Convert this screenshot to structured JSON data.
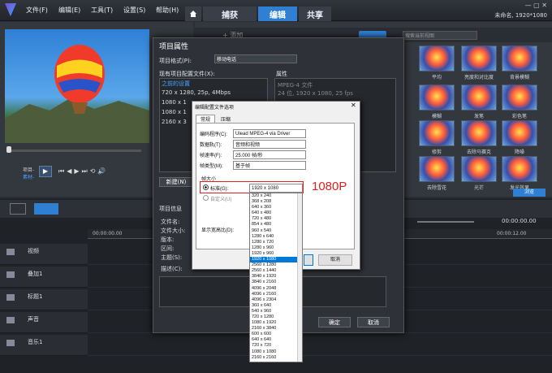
{
  "app": {
    "title": "未命名, 1920*1080"
  },
  "menu": [
    "文件(F)",
    "编辑(E)",
    "工具(T)",
    "设置(S)",
    "帮助(H)"
  ],
  "tabs": {
    "capture": "捕获",
    "edit": "编辑",
    "share": "共享"
  },
  "library": {
    "add": "添加",
    "search_placeholder": "搜索当前视图",
    "items": [
      {
        "label": ""
      },
      {
        "label": "平均"
      },
      {
        "label": "亮度和对比度"
      },
      {
        "label": "背景模糊"
      },
      {
        "label": "模糊"
      },
      {
        "label": "发笔"
      },
      {
        "label": "彩色笔"
      },
      {
        "label": "修剪"
      },
      {
        "label": "去除马赛克"
      },
      {
        "label": "降噪"
      },
      {
        "label": "去除雪花"
      },
      {
        "label": "光芒"
      },
      {
        "label": "发光效果"
      }
    ],
    "footer": "浏览"
  },
  "player": {
    "project": "项目-",
    "clip": "素材-"
  },
  "timeline": {
    "time": "00:00:00.00",
    "ruler": [
      "00:00:00.00",
      "00:00:02.00",
      "00:00:12.00"
    ],
    "tracks": [
      "视频",
      "叠加1",
      "标题1",
      "声音",
      "音乐1"
    ]
  },
  "project_props": {
    "title": "项目属性",
    "format_label": "项目格式(P):",
    "format_value": "移动电话",
    "profiles_label": "现有项目配置文件(X):",
    "profiles": [
      "之前的设置",
      "720 x 1280, 25p, 4Mbps",
      "1080 x 1",
      "1080 x 1",
      "2160 x 3"
    ],
    "attributes_label": "属性",
    "attributes": [
      "MPEG-4 文件",
      "24 位, 1920 x 1080, 25 fps"
    ],
    "new_button": "新建(N)",
    "info_label": "项目信息",
    "info_fields": [
      "文件名:",
      "文件大小:",
      "版本:",
      "区间:",
      "主题(S):",
      "描述(C):"
    ],
    "ok": "确定",
    "cancel": "取消"
  },
  "edit_dialog": {
    "title": "编辑配置文件选项",
    "tabs": [
      "常规",
      "压缩"
    ],
    "fields": [
      {
        "label": "编码程序(C):",
        "value": "Ulead MPEG-4 via Driver"
      },
      {
        "label": "数据轨(T):",
        "value": "音频和视频"
      },
      {
        "label": "帧速率(F):",
        "value": "25.000 帧/秒"
      },
      {
        "label": "帧类型(M):",
        "value": "基于帧"
      }
    ],
    "size_group": "帧大小",
    "standard": "标准(G):",
    "standard_value": "1920 x 1080",
    "custom": "自定义(U)",
    "aspect": "显示宽高比(D):",
    "ok": "",
    "cancel": "取消"
  },
  "size_list": [
    "320 x 240",
    "368 x 208",
    "640 x 360",
    "640 x 480",
    "720 x 480",
    "854 x 480",
    "960 x 540",
    "1280 x 640",
    "1280 x 720",
    "1280 x 960",
    "1920 x 960",
    "1920 x 1080",
    "2560 x 1280",
    "2560 x 1440",
    "3840 x 1920",
    "3840 x 2160",
    "4096 x 2048",
    "4096 x 2160",
    "4096 x 2304",
    "360 x 640",
    "540 x 960",
    "720 x 1280",
    "1080 x 1920",
    "2160 x 3840",
    "600 x 600",
    "640 x 640",
    "720 x 720",
    "1080 x 1080",
    "2160 x 2160"
  ],
  "selected_size_index": 11,
  "annotation": {
    "text": "1080P",
    "color": "#e0201f"
  },
  "colors": {
    "accent": "#2f7fd3",
    "annotation": "#e0201f"
  }
}
